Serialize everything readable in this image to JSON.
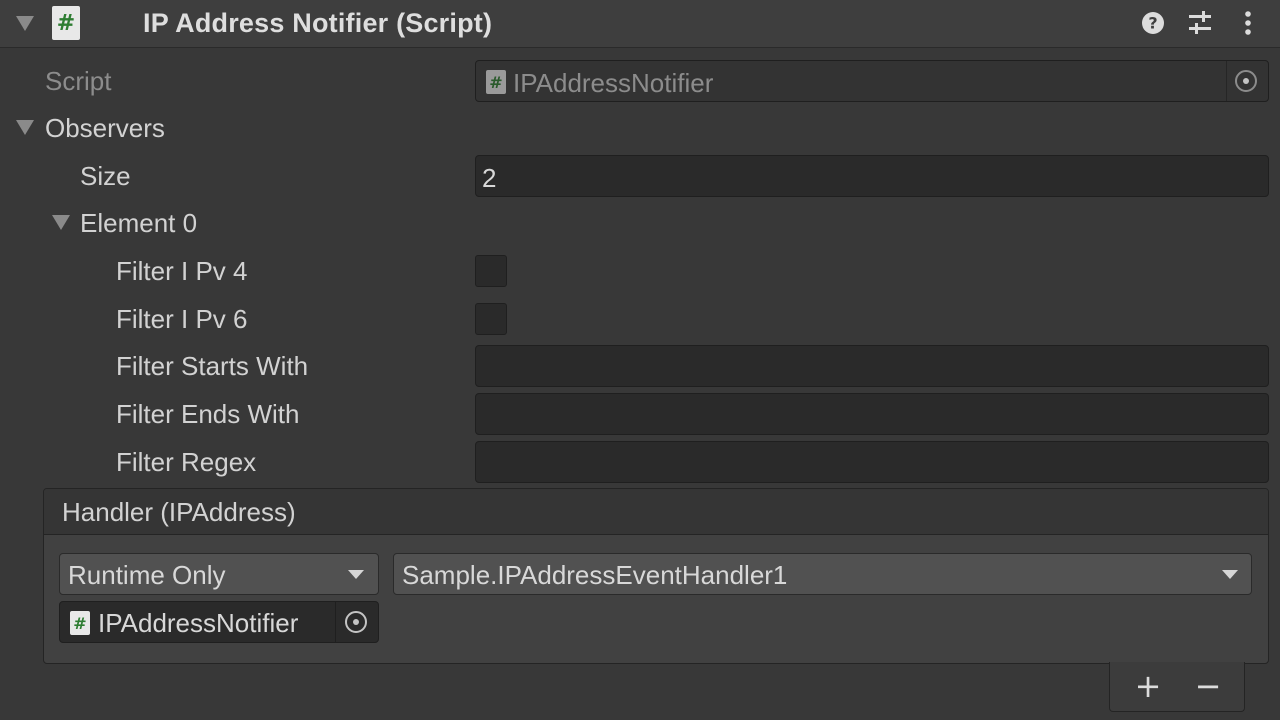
{
  "component": {
    "title": "IP Address Notifier (Script)",
    "header_icons": [
      "help-icon",
      "preset-sliders-icon",
      "more-menu-icon"
    ]
  },
  "script_field": {
    "label": "Script",
    "value": "IPAddressNotifier"
  },
  "observers": {
    "label": "Observers",
    "size_label": "Size",
    "size_value": "2",
    "element_label": "Element 0",
    "fields": {
      "filter_ipv4_label": "Filter I Pv 4",
      "filter_ipv6_label": "Filter I Pv 6",
      "filter_starts_with_label": "Filter Starts With",
      "filter_ends_with_label": "Filter Ends With",
      "filter_regex_label": "Filter Regex"
    }
  },
  "handler": {
    "title": "Handler (IPAddress)",
    "call_state": "Runtime Only",
    "function": "Sample.IPAddressEventHandler1",
    "target_object": "IPAddressNotifier"
  },
  "list_buttons": {
    "add": "+",
    "remove": "−"
  },
  "colors": {
    "background": "#383838",
    "field_bg": "#2a2a2a",
    "script_icon_green": "#2e7d32"
  }
}
